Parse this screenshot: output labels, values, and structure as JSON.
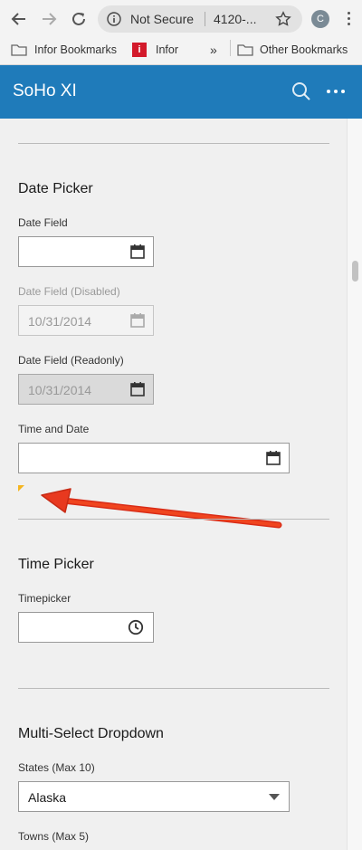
{
  "browser": {
    "omnibox": {
      "security_label": "Not Secure",
      "url": "4120-..."
    },
    "profile_initial": "C",
    "bookmarks": [
      {
        "label": "Infor Bookmarks",
        "icon": "folder-icon"
      },
      {
        "label": "Infor",
        "icon": "infor-logo-icon"
      },
      {
        "label": "»",
        "icon": "overflow-chevron"
      },
      {
        "label": "Other Bookmarks",
        "icon": "folder-icon"
      }
    ]
  },
  "app": {
    "title": "SoHo XI",
    "accent_color": "#1f7bba"
  },
  "date_picker": {
    "title": "Date Picker",
    "fields": [
      {
        "label": "Date Field",
        "value": "",
        "state": "normal"
      },
      {
        "label": "Date Field (Disabled)",
        "value": "10/31/2014",
        "state": "disabled"
      },
      {
        "label": "Date Field (Readonly)",
        "value": "10/31/2014",
        "state": "readonly"
      },
      {
        "label": "Time and Date",
        "value": "",
        "state": "normal"
      }
    ]
  },
  "time_picker": {
    "title": "Time Picker",
    "field": {
      "label": "Timepicker",
      "value": ""
    }
  },
  "multiselect": {
    "title": "Multi-Select Dropdown",
    "states": {
      "label": "States (Max 10)",
      "value": "Alaska"
    },
    "towns": {
      "label": "Towns (Max 5)"
    }
  },
  "annotation": {
    "arrow_color": "#e8391f",
    "warning_color": "#f5b51f"
  }
}
